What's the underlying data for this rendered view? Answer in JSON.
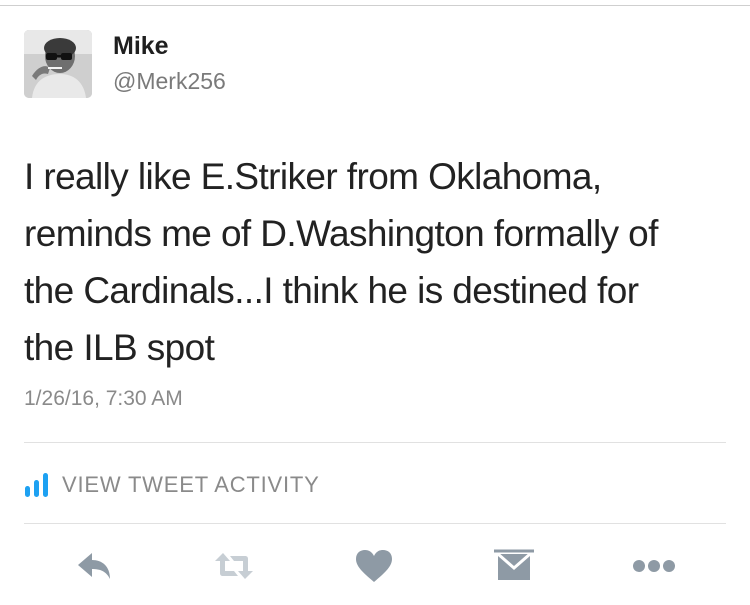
{
  "user": {
    "display_name": "Mike",
    "handle": "@Merk256"
  },
  "tweet": {
    "lines": [
      "I really like E.Striker from Oklahoma,",
      "reminds me of D.Washington formally of",
      "the Cardinals...I think he is destined for",
      "the ILB spot"
    ],
    "timestamp": "1/26/16, 7:30 AM"
  },
  "activity": {
    "label": "VIEW TWEET ACTIVITY",
    "icon": "bar-chart-icon"
  },
  "actions": [
    {
      "name": "reply",
      "icon": "reply-icon"
    },
    {
      "name": "retweet",
      "icon": "retweet-icon"
    },
    {
      "name": "like",
      "icon": "heart-icon"
    },
    {
      "name": "direct-message",
      "icon": "envelope-icon"
    },
    {
      "name": "more",
      "icon": "more-icon"
    }
  ],
  "colors": {
    "icon_gray": "#8e9aa5",
    "text": "#222222",
    "muted": "#8a8a8a"
  }
}
